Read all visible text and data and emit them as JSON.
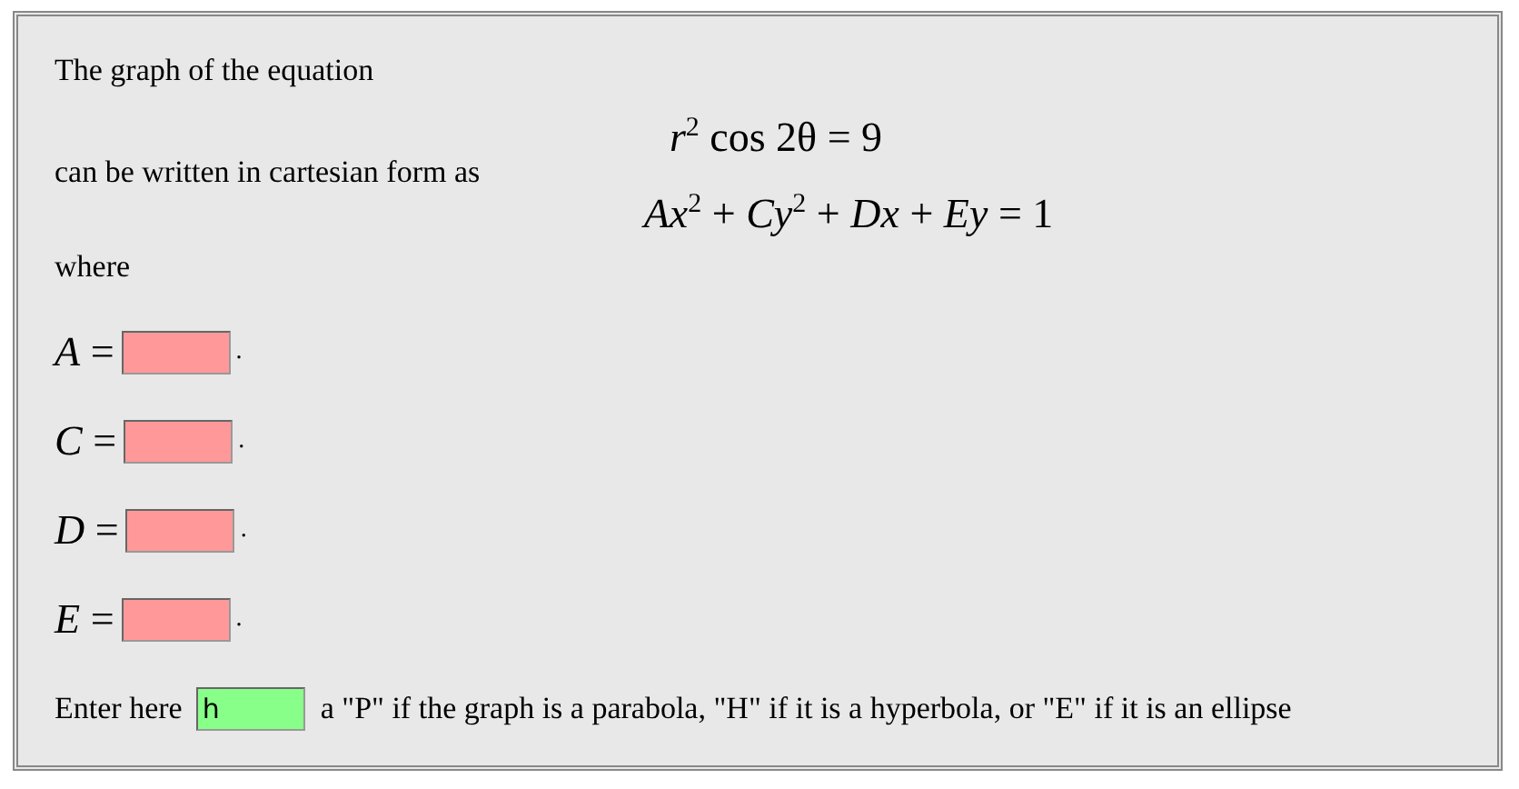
{
  "intro": "The graph of the equation",
  "polar_equation": "*r*$^{2}$ cos 2θ = 9",
  "transition": "can be written in cartesian form as",
  "cartesian_equation": "*Ax*$^{2}$ + *Cy*$^{2}$ + *Dx* + *Ey* = 1",
  "where": "where",
  "coefficients": [
    {
      "label": "*A* =",
      "correct": false,
      "end": "."
    },
    {
      "label": "*C* =",
      "correct": false,
      "end": "."
    },
    {
      "label": "*D* =",
      "correct": false,
      "end": "."
    },
    {
      "label": "*E* =",
      "correct": false,
      "end": "."
    }
  ],
  "type_prompt": {
    "label": "Enter here",
    "value": "h",
    "correct": true,
    "instruction": "a \"P\" if the graph is a parabola, \"H\" if it is a hyperbola, or \"E\" if it is an ellipse"
  }
}
